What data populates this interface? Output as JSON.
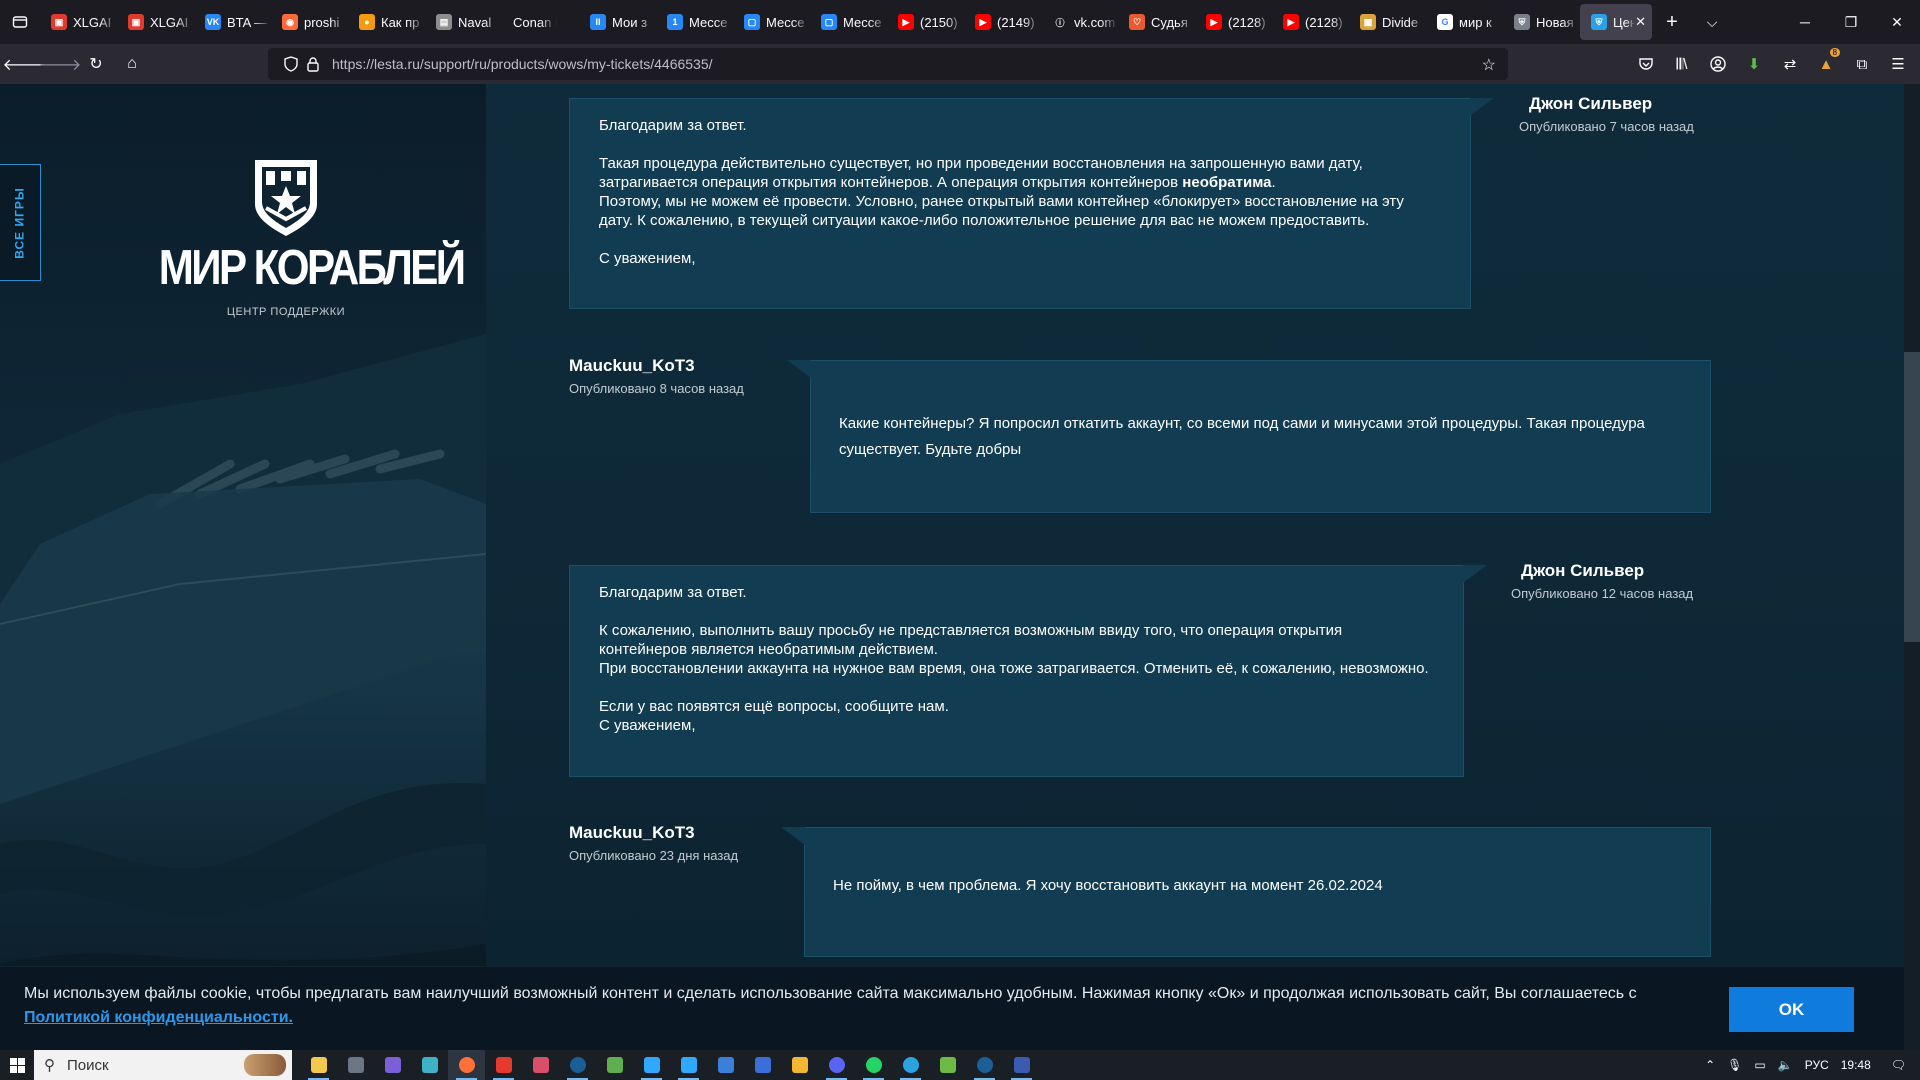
{
  "browser": {
    "tabs": [
      {
        "label": "XLGAI",
        "color": "#e03a2f",
        "glyph": "▣"
      },
      {
        "label": "XLGAI",
        "color": "#e03a2f",
        "glyph": "▣"
      },
      {
        "label": "BTA —",
        "color": "#2787f5",
        "glyph": "VK"
      },
      {
        "label": "proshi",
        "color": "#ff6a3d",
        "glyph": "◉"
      },
      {
        "label": "Как пр",
        "color": "#f39c12",
        "glyph": "●"
      },
      {
        "label": "Naval",
        "color": "#8e8e8e",
        "glyph": "▤"
      },
      {
        "label": "Conan Exil",
        "color": "",
        "glyph": ""
      },
      {
        "label": "Мои з",
        "color": "#2787f5",
        "glyph": "II"
      },
      {
        "label": "Мессе",
        "color": "#2787f5",
        "glyph": "1"
      },
      {
        "label": "Мессе",
        "color": "#2787f5",
        "glyph": "▢"
      },
      {
        "label": "Мессе",
        "color": "#2787f5",
        "glyph": "▢"
      },
      {
        "label": "(2150)",
        "color": "#ff0000",
        "glyph": "▶"
      },
      {
        "label": "(2149)",
        "color": "#ff0000",
        "glyph": "▶"
      },
      {
        "label": "vk.com",
        "color": "#1c1b22",
        "glyph": "ⓘ"
      },
      {
        "label": "Судья",
        "color": "#e85a2f",
        "glyph": "♡"
      },
      {
        "label": "(2128)",
        "color": "#ff0000",
        "glyph": "▶"
      },
      {
        "label": "(2128)",
        "color": "#ff0000",
        "glyph": "▶"
      },
      {
        "label": "Divide",
        "color": "#d9a43a",
        "glyph": "▦"
      },
      {
        "label": "мир к",
        "color": "#ffffff",
        "glyph": "G"
      },
      {
        "label": "Новая",
        "color": "#7a7f8a",
        "glyph": "⛨"
      },
      {
        "label": "Цен",
        "color": "#2aa0e8",
        "glyph": "⛨"
      }
    ],
    "new_tab": "+",
    "url": "https://lesta.ru/support/ru/products/wows/my-tickets/4466535/",
    "extension_badge": "8"
  },
  "sidebar": {
    "all_games": "ВСЕ ИГРЫ",
    "brand": "МИР КОРАБЛЕЙ",
    "subtitle": "ЦЕНТР ПОДДЕРЖКИ"
  },
  "messages": [
    {
      "author": "Джон Сильвер",
      "time": "Опубликовано 7 часов назад",
      "p1": "Благодарим за ответ.",
      "p2a": "Такая процедура действительно существует, но при проведении восстановления на запрошенную вами дату, затрагивается операция открытия контейнеров. А операция открытия контейнеров ",
      "p2b": "необратима",
      "p2c": ".",
      "p3": "Поэтому, мы не можем её провести. Условно, ранее открытый вами контейнер «блокирует» восстановление на эту дату. К сожалению, в текущей ситуации какое-либо положительное решение для вас не можем предоставить.",
      "p4": "С уважением,"
    },
    {
      "author": "Mauckuu_KoT3",
      "time": "Опубликовано 8 часов назад",
      "text": "Какие контейнеры? Я попросил откатить аккаунт, со всеми под сами и минусами этой процедуры. Такая процедура существует. Будьте добры"
    },
    {
      "author": "Джон Сильвер",
      "time": "Опубликовано 12 часов назад",
      "p1": "Благодарим за ответ.",
      "p2": "К сожалению, выполнить вашу просьбу не представляется возможным ввиду того, что операция открытия контейнеров является необратимым действием.",
      "p3": "При восстановлении аккаунта на нужное вам время, она тоже затрагивается. Отменить её, к сожалению, невозможно.",
      "p4": "Если у вас появятся ещё вопросы, сообщите нам.",
      "p5": "С уважением,"
    },
    {
      "author": "Mauckuu_KoT3",
      "time": "Опубликовано 23 дня назад",
      "text": "Не пойму, в чем проблема. Я хочу восстановить аккаунт на момент 26.02.2024"
    }
  ],
  "cookie": {
    "text": "Мы используем файлы cookie, чтобы предлагать вам наилучший возможный контент и сделать использование сайта максимально удобным. Нажимая кнопку «Ок» и продолжая использовать сайт, Вы соглашаетесь с ",
    "link": "Политикой конфиденциальности.",
    "ok": "OK"
  },
  "taskbar": {
    "search_placeholder": "Поиск",
    "apps": [
      {
        "name": "explorer",
        "color": "#f2c94c"
      },
      {
        "name": "app-2",
        "color": "#6b7785"
      },
      {
        "name": "app-3",
        "color": "#7b5fd6"
      },
      {
        "name": "app-4",
        "color": "#3fb3c5"
      },
      {
        "name": "firefox",
        "color": "#ff7139"
      },
      {
        "name": "yandex",
        "color": "#e63a2e"
      },
      {
        "name": "app-7",
        "color": "#d94f6a"
      },
      {
        "name": "steam",
        "color": "#1b5f98"
      },
      {
        "name": "app-9",
        "color": "#5fae4f"
      },
      {
        "name": "photoshop",
        "color": "#31a8ff"
      },
      {
        "name": "lightroom",
        "color": "#31a8ff"
      },
      {
        "name": "app-12",
        "color": "#3c7fd8"
      },
      {
        "name": "app-13",
        "color": "#3b6ed8"
      },
      {
        "name": "app-14",
        "color": "#f5b731"
      },
      {
        "name": "discord",
        "color": "#5865f2"
      },
      {
        "name": "whatsapp",
        "color": "#25d366"
      },
      {
        "name": "telegram",
        "color": "#2aa3e0"
      },
      {
        "name": "app-18",
        "color": "#6dbb44"
      },
      {
        "name": "steam-2",
        "color": "#1b5f98"
      },
      {
        "name": "lesta",
        "color": "#3a5bb0"
      }
    ],
    "lang": "РУС",
    "clock": "19:48"
  }
}
